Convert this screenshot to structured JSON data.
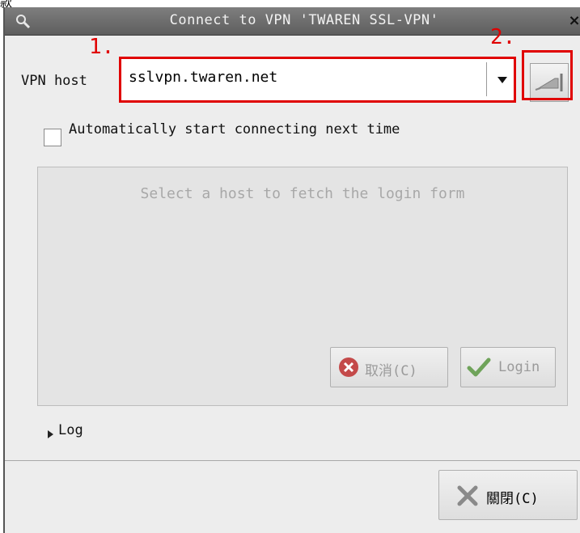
{
  "window": {
    "title": "Connect to VPN 'TWAREN SSL-VPN'",
    "close_glyph": "×"
  },
  "annotations": {
    "marker_1": "1.",
    "marker_2": "2.",
    "highlight_color": "#e00000"
  },
  "form": {
    "vpn_host_label": "VPN host",
    "vpn_host_value": "sslvpn.twaren.net",
    "auto_connect_label": "Automatically start connecting next time",
    "auto_connect_checked": false
  },
  "login_panel": {
    "placeholder": "Select a host to fetch the login form",
    "cancel_label": "取消(C)",
    "login_label": "Login"
  },
  "log": {
    "label": "Log",
    "expanded": false
  },
  "footer": {
    "close_label": "關閉(C)"
  },
  "icons": {
    "title": "search-icon",
    "connect": "connect-plug-icon",
    "cancel": "cancel-circle-icon",
    "login": "checkmark-icon",
    "close": "close-x-icon"
  }
}
